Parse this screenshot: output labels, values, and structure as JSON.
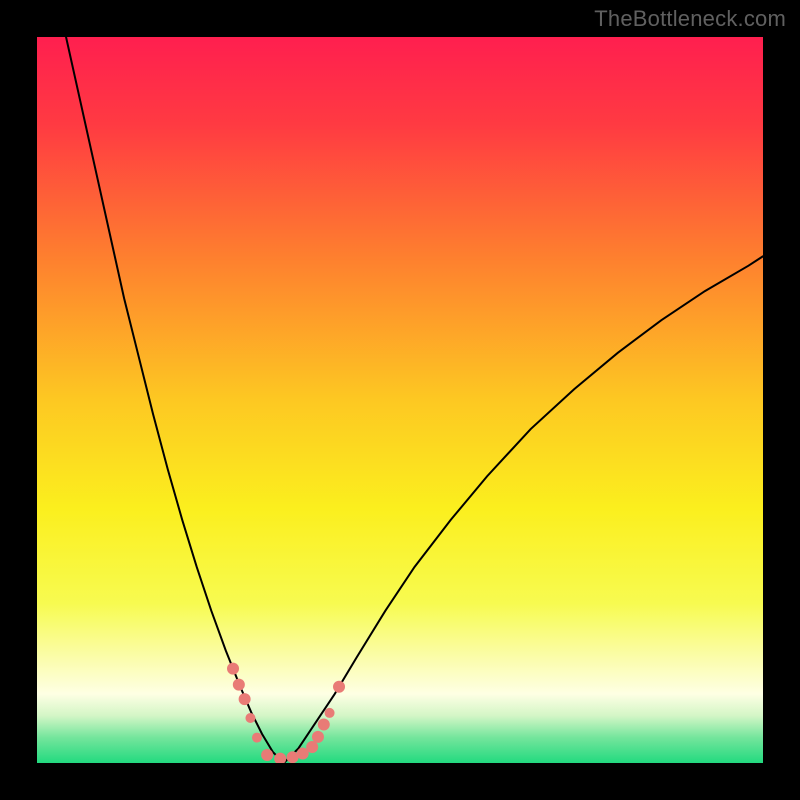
{
  "watermark": "TheBottleneck.com",
  "chart_data": {
    "type": "line",
    "title": "",
    "xlabel": "",
    "ylabel": "",
    "xlim": [
      0,
      100
    ],
    "ylim": [
      0,
      100
    ],
    "background_gradient": {
      "stops": [
        {
          "pos": 0.0,
          "color": "#ff1f4f"
        },
        {
          "pos": 0.12,
          "color": "#ff3a42"
        },
        {
          "pos": 0.3,
          "color": "#fe7e2f"
        },
        {
          "pos": 0.5,
          "color": "#fdc822"
        },
        {
          "pos": 0.65,
          "color": "#fbef1e"
        },
        {
          "pos": 0.78,
          "color": "#f7fb50"
        },
        {
          "pos": 0.86,
          "color": "#fbfdb0"
        },
        {
          "pos": 0.905,
          "color": "#feffe4"
        },
        {
          "pos": 0.935,
          "color": "#d3f6c6"
        },
        {
          "pos": 0.965,
          "color": "#74e59c"
        },
        {
          "pos": 1.0,
          "color": "#22da7f"
        }
      ]
    },
    "series": [
      {
        "name": "left-curve",
        "x": [
          4,
          6,
          8,
          10,
          12,
          14,
          16,
          18,
          20,
          22,
          24,
          26,
          28,
          29.5,
          31,
          32.5,
          34
        ],
        "y": [
          100,
          91,
          82,
          73,
          64,
          56,
          48,
          40.5,
          33.5,
          27,
          21,
          15.5,
          10.5,
          7,
          4,
          1.5,
          0
        ],
        "stroke": "#000000",
        "width": 2
      },
      {
        "name": "right-curve",
        "x": [
          34,
          36,
          38,
          41,
          44,
          48,
          52,
          57,
          62,
          68,
          74,
          80,
          86,
          92,
          98,
          100
        ],
        "y": [
          0,
          2,
          5,
          9.5,
          14.5,
          21,
          27,
          33.5,
          39.5,
          46,
          51.5,
          56.5,
          61,
          65,
          68.5,
          69.8
        ],
        "stroke": "#000000",
        "width": 2
      },
      {
        "name": "fit-markers",
        "type": "scatter",
        "points": [
          {
            "x": 27.0,
            "y": 13.0,
            "r": 6
          },
          {
            "x": 27.8,
            "y": 10.8,
            "r": 6
          },
          {
            "x": 28.6,
            "y": 8.8,
            "r": 6
          },
          {
            "x": 29.4,
            "y": 6.2,
            "r": 5
          },
          {
            "x": 30.3,
            "y": 3.5,
            "r": 5
          },
          {
            "x": 31.7,
            "y": 1.1,
            "r": 6
          },
          {
            "x": 33.5,
            "y": 0.6,
            "r": 6
          },
          {
            "x": 35.2,
            "y": 0.8,
            "r": 6
          },
          {
            "x": 36.6,
            "y": 1.3,
            "r": 6
          },
          {
            "x": 37.9,
            "y": 2.2,
            "r": 6
          },
          {
            "x": 38.7,
            "y": 3.6,
            "r": 6
          },
          {
            "x": 39.5,
            "y": 5.3,
            "r": 6
          },
          {
            "x": 40.3,
            "y": 6.9,
            "r": 5
          },
          {
            "x": 41.6,
            "y": 10.5,
            "r": 6
          }
        ],
        "fill": "#e97b76"
      }
    ]
  }
}
